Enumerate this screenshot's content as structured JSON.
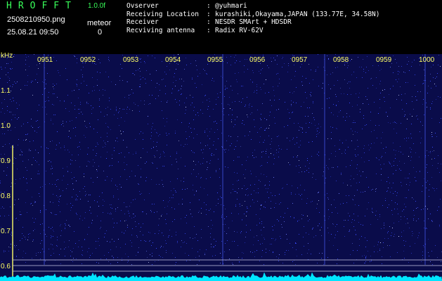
{
  "header": {
    "app_title": "HROFFT",
    "version": "1.0.0f",
    "filename": "2508210950.png",
    "meteor_label": "meteor",
    "meteor_count": "0",
    "timestamp": "25.08.21 09:50"
  },
  "station_info": [
    {
      "key": "Ovserver",
      "value": "@yuhmari"
    },
    {
      "key": "Receiving Location",
      "value": "kurashiki,Okayama,JAPAN (133.77E, 34.58N)"
    },
    {
      "key": "Receiver",
      "value": "NESDR SMArt + HDSDR"
    },
    {
      "key": "Recviving antenna",
      "value": "Radix RV-62V"
    }
  ],
  "waterfall": {
    "freq_unit": "kHz",
    "freq_ticks": [
      "1.1",
      "1.0",
      "0.9",
      "0.8",
      "0.7",
      "0.6"
    ],
    "time_ticks": [
      "0951",
      "0952",
      "0953",
      "0954",
      "0955",
      "0956",
      "0957",
      "0958",
      "0959",
      "1000"
    ],
    "colors": {
      "background": "#0a0c4a",
      "noise": "#3a4dff",
      "spectrum": "#00e5ff",
      "labels": "#ffff66",
      "title": "#39ff5a"
    }
  }
}
